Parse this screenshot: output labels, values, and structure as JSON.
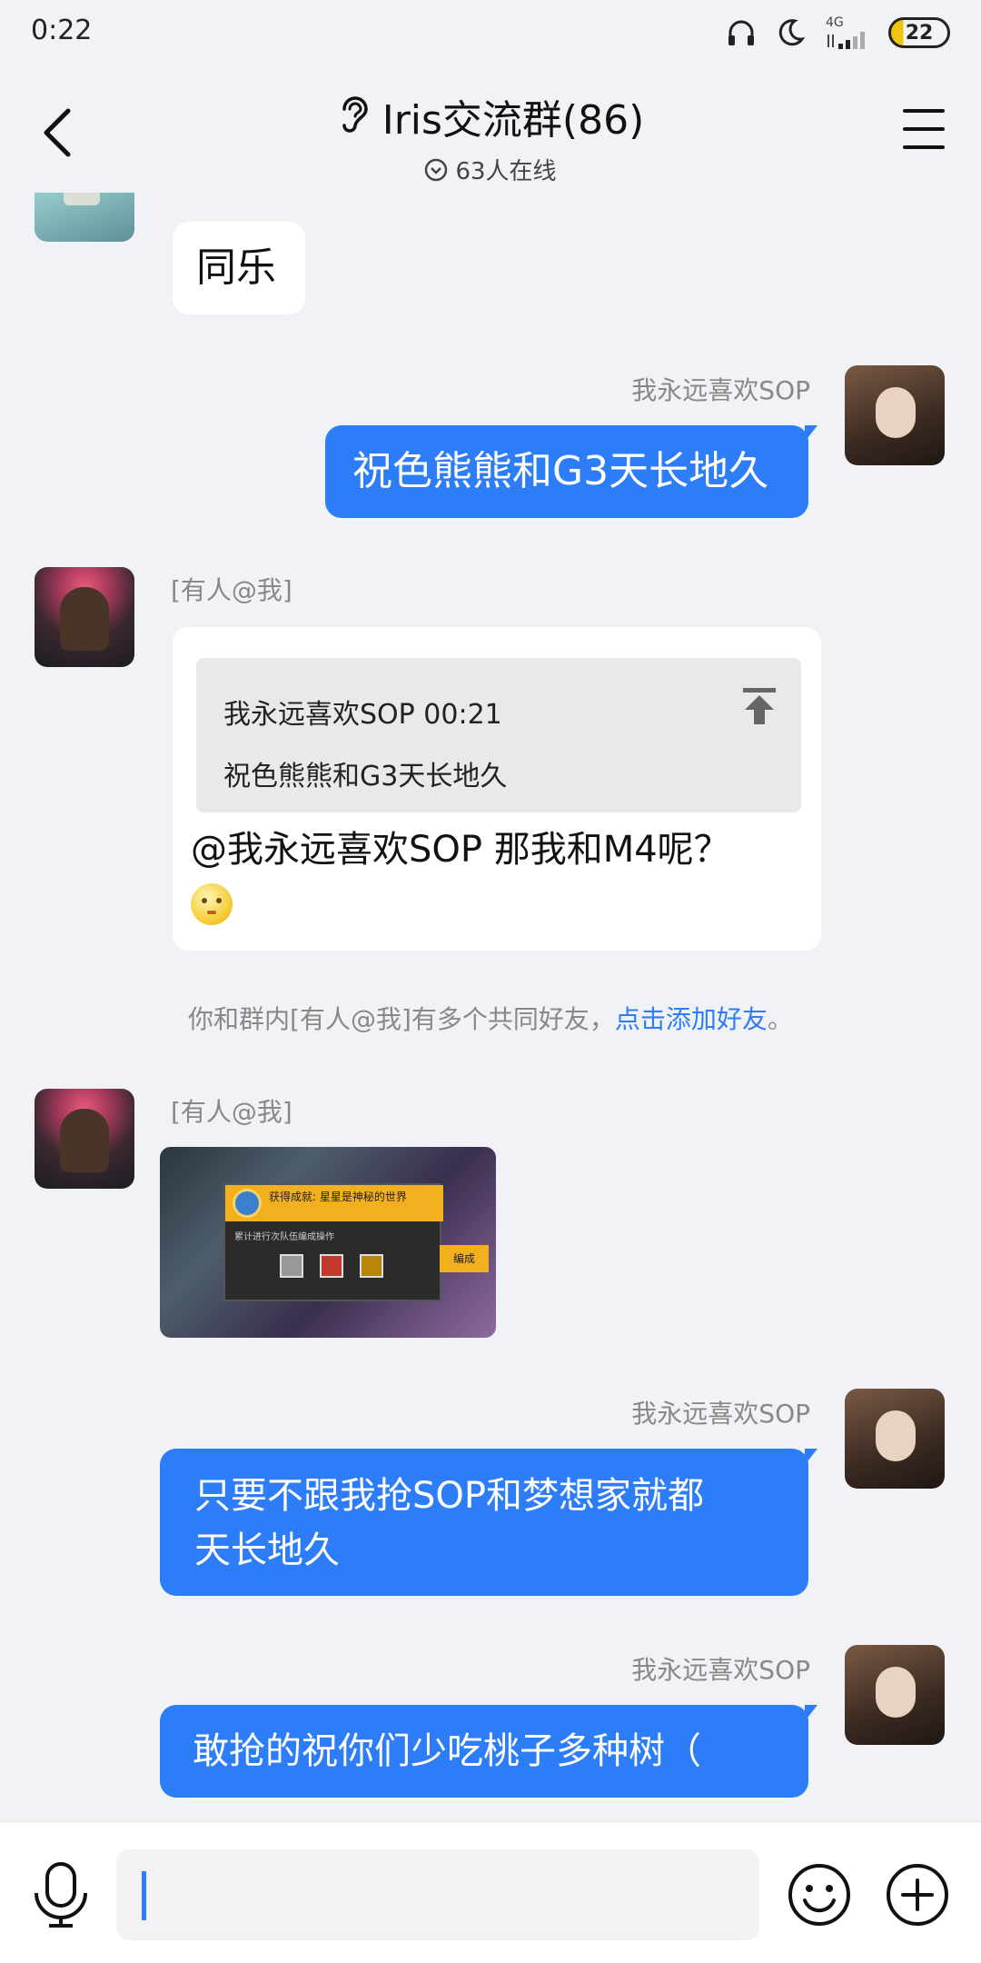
{
  "status_bar": {
    "time": "0:22",
    "network": "4G",
    "battery": "22"
  },
  "header": {
    "title": "Iris交流群(86)",
    "online": "63人在线"
  },
  "messages": {
    "m1": {
      "text": "同乐"
    },
    "m2": {
      "sender": "我永远喜欢SOP",
      "text": "祝色熊熊和G3天长地久"
    },
    "m3": {
      "sender": "[有人@我]",
      "quote_meta": "我永远喜欢SOP 00:21",
      "quote_text": "祝色熊熊和G3天长地久",
      "text": "@我永远喜欢SOP 那我和M4呢？"
    },
    "tip": {
      "text": "你和群内[有人@我]有多个共同好友，",
      "link": "点击添加好友",
      "end": "。"
    },
    "m4": {
      "sender": "[有人@我]",
      "image_banner": "获得成就: 星星是神秘的世界",
      "image_sub": "累计进行次队伍编成操作",
      "image_btn": "编成"
    },
    "m5": {
      "sender": "我永远喜欢SOP",
      "text_line1": "只要不跟我抢SOP和梦想家就都",
      "text_line2": "天长地久"
    },
    "m6": {
      "sender": "我永远喜欢SOP",
      "text": "敢抢的祝你们少吃桃子多种树（"
    }
  },
  "input": {
    "placeholder": ""
  },
  "colors": {
    "accent": "#2c7df7",
    "background": "#f1f2f6"
  },
  "icons": {
    "back": "chevron-left-icon",
    "menu": "hamburger-menu-icon",
    "group": "ear-icon",
    "online": "chevron-down-circle-icon",
    "voice": "microphone-icon",
    "emoji": "smiley-icon",
    "more": "plus-circle-icon"
  }
}
